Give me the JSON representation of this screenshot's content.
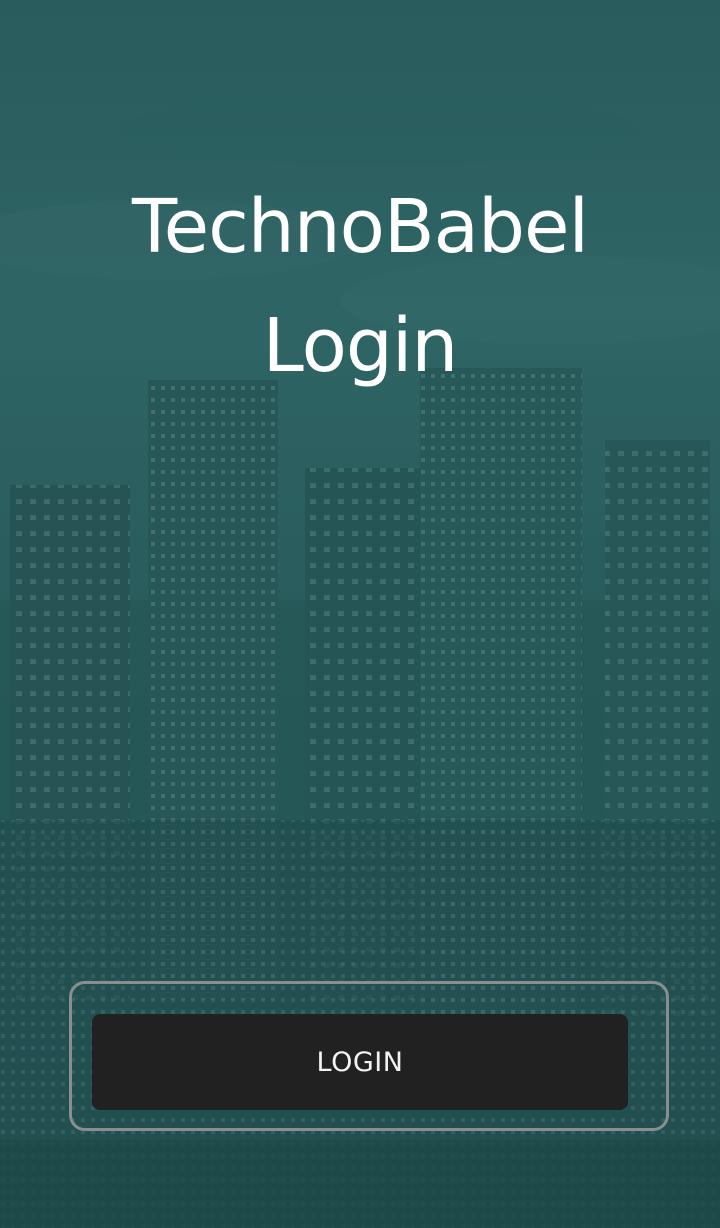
{
  "app": {
    "title": "TechnoBabel",
    "subtitle": "Login"
  },
  "login": {
    "button_label": "LOGIN"
  },
  "background": {
    "description_icon": "city-skyline-image",
    "accent": "#2e6060"
  },
  "colors": {
    "button_bg": "#212121",
    "button_text": "#f2f2f2",
    "frame_border": "#8a8e8e",
    "title_text": "#ffffff"
  }
}
